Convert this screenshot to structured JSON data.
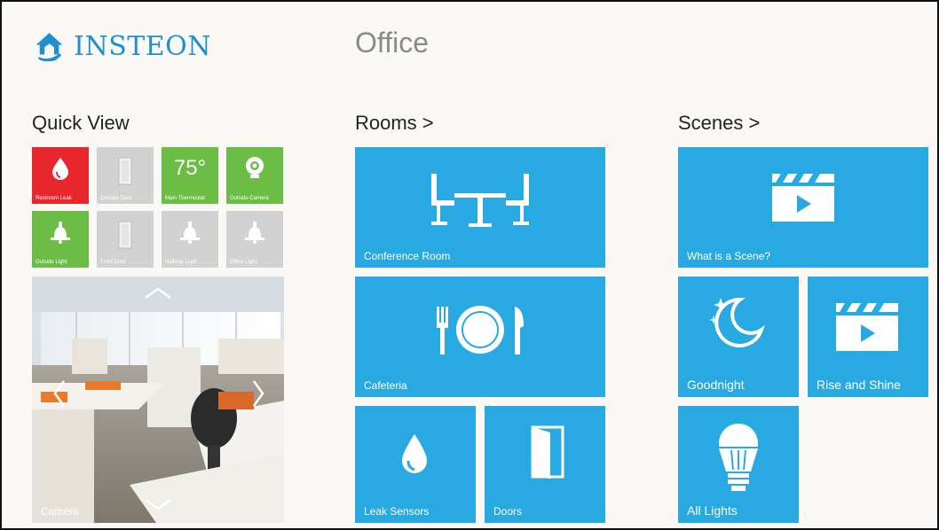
{
  "brand": {
    "name": "INSTEON"
  },
  "page": {
    "title": "Office"
  },
  "quick_view": {
    "heading": "Quick View",
    "tiles": [
      {
        "label": "Restroom Leak",
        "icon": "water-drop-icon"
      },
      {
        "label": "Outside Door",
        "icon": "door-icon"
      },
      {
        "label": "Main Thermostat",
        "value": "75°",
        "icon": "thermostat-icon"
      },
      {
        "label": "Outside Camera",
        "icon": "camera-icon"
      },
      {
        "label": "Outside Light",
        "icon": "lamp-icon"
      },
      {
        "label": "Front Door",
        "icon": "door-icon"
      },
      {
        "label": "Hallway Light",
        "icon": "lamp-icon"
      },
      {
        "label": "Office Light",
        "icon": "lamp-icon"
      }
    ],
    "camera": {
      "label": "Camera"
    }
  },
  "rooms": {
    "heading": "Rooms >",
    "tiles": [
      {
        "label": "Conference Room",
        "icon": "conference-table-icon"
      },
      {
        "label": "Cafeteria",
        "icon": "plate-cutlery-icon"
      },
      {
        "label": "Leak Sensors",
        "icon": "water-drop-icon"
      },
      {
        "label": "Doors",
        "icon": "door-icon"
      }
    ]
  },
  "scenes": {
    "heading": "Scenes >",
    "tiles": [
      {
        "label": "What is a Scene?",
        "icon": "clapperboard-icon"
      },
      {
        "label": "Goodnight",
        "icon": "moon-stars-icon"
      },
      {
        "label": "Rise and Shine",
        "icon": "clapperboard-icon"
      },
      {
        "label": "All Lights",
        "icon": "light-bulb-icon"
      }
    ]
  },
  "colors": {
    "tile_blue": "#29a9e1",
    "alert_red": "#e8262d",
    "active_green": "#6cbd45",
    "inactive_grey": "#d2d2d2",
    "brand_blue": "#1e90d0"
  }
}
